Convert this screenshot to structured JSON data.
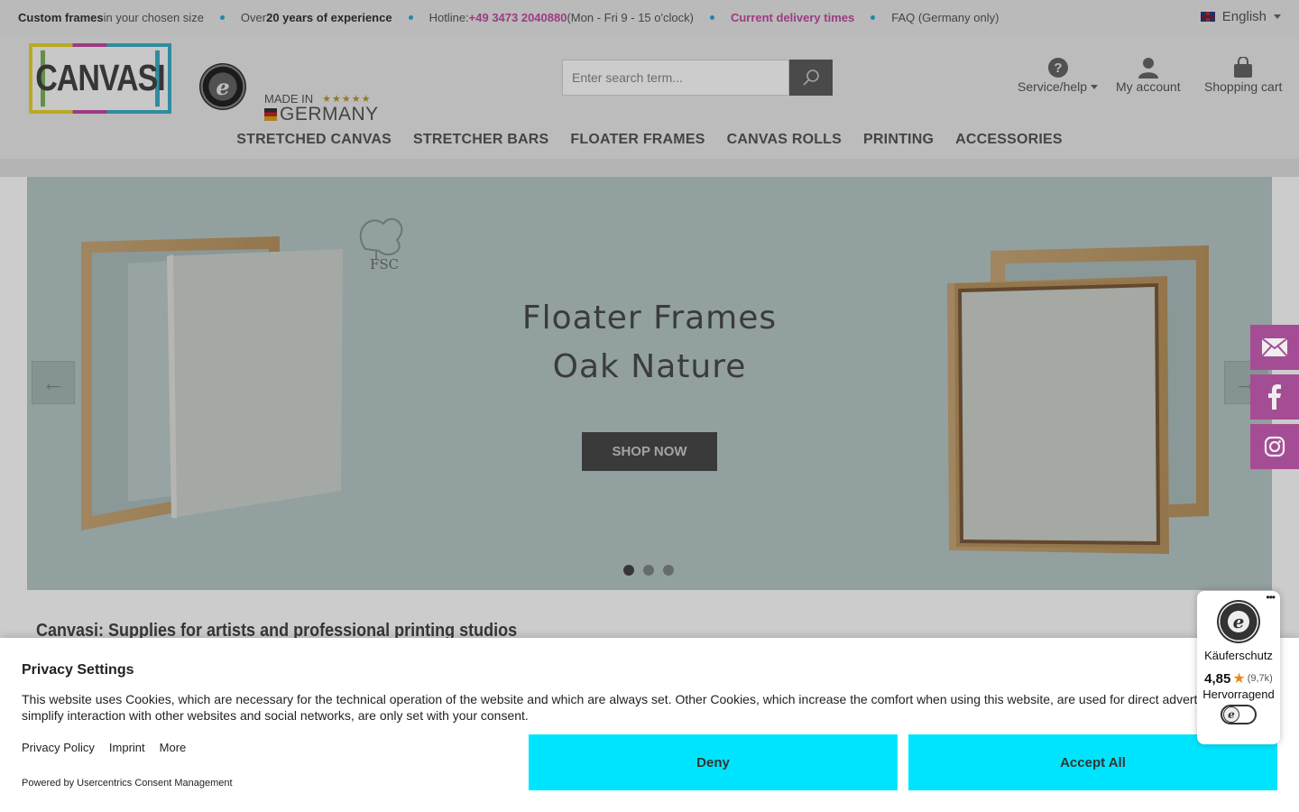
{
  "topbar": {
    "frames_bold": "Custom frames",
    "frames_rest": " in your chosen size",
    "experience_pre": "Over ",
    "experience_bold": "20 years of experience",
    "hotline_label": "Hotline: ",
    "hotline_number": "+49 3473 2040880",
    "hotline_hours": " (Mon - Fri 9 - 15 o'clock)",
    "delivery": "Current delivery times",
    "faq": "FAQ (Germany only)",
    "language": "English"
  },
  "header": {
    "logo_text": "CANVASI",
    "badge_letter": "e",
    "made_in_label": "MADE IN",
    "made_in_stars": "★★★★★",
    "made_in_country": "GERMANY",
    "search_placeholder": "Enter search term...",
    "service_label": "Service/help",
    "account_label": "My account",
    "cart_label": "Shopping cart"
  },
  "nav": {
    "items": [
      "STRETCHED CANVAS",
      "STRETCHER BARS",
      "FLOATER FRAMES",
      "CANVAS ROLLS",
      "PRINTING",
      "ACCESSORIES"
    ]
  },
  "hero": {
    "title_line1": "Floater Frames",
    "title_line2": "Oak Nature",
    "button": "SHOP NOW",
    "fsc_label": "FSC",
    "prev_arrow": "←",
    "next_arrow": "→",
    "slide_count": 3,
    "active_slide": 1
  },
  "section_heading": "Canvasi: Supplies for artists and professional printing studios",
  "consent": {
    "title": "Privacy Settings",
    "text_line1": "This website uses Cookies, which are necessary for the technical operation of the website and which are always set. Other Cookies, which increase the comfort when using this website, are used for direct adverti",
    "text_line2": "simplify interaction with other websites and social networks, are only set with your consent.",
    "link_privacy": "Privacy Policy",
    "link_imprint": "Imprint",
    "link_more": "More",
    "powered": "Powered by Usercentrics Consent Management",
    "deny": "Deny",
    "accept": "Accept All"
  },
  "trusted_widget": {
    "more": "•••",
    "seal_letter": "e",
    "label": "Käuferschutz",
    "score": "4,85",
    "star": "★",
    "count": "(9,7k)",
    "verdict": "Hervorragend"
  },
  "colors": {
    "accent_pink": "#c34aa4",
    "side_tab": "#a54d94",
    "consent_button": "#00e5ff",
    "topbar_dot": "#2aa8d8"
  }
}
